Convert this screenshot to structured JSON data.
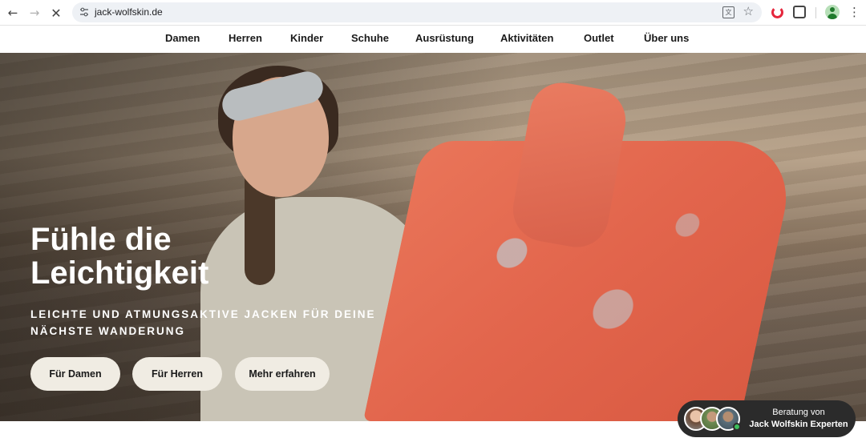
{
  "browser": {
    "url": "jack-wolfskin.de",
    "icons": [
      "back-icon",
      "forward-icon",
      "stop-icon",
      "tune-icon",
      "translate-icon",
      "bookmark-star-icon",
      "opera-extension-icon",
      "extensions-puzzle-icon",
      "profile-icon",
      "kebab-menu-icon"
    ]
  },
  "nav": {
    "items": [
      {
        "label": "Damen"
      },
      {
        "label": "Herren"
      },
      {
        "label": "Kinder"
      },
      {
        "label": "Schuhe"
      },
      {
        "label": "Ausrüstung"
      },
      {
        "label": "Aktivitäten"
      },
      {
        "label": "Outlet"
      },
      {
        "label": "Über uns"
      }
    ]
  },
  "hero": {
    "title_line1": "Fühle die",
    "title_line2": "Leichtigkeit",
    "subtitle_line1": "LEICHTE UND ATMUNGSAKTIVE JACKEN FÜR DEINE",
    "subtitle_line2": "NÄCHSTE WANDERUNG",
    "buttons": [
      {
        "label": "Für Damen"
      },
      {
        "label": "Für Herren"
      },
      {
        "label": "Mehr erfahren"
      }
    ]
  },
  "chat": {
    "line1": "Beratung von",
    "line2": "Jack Wolfskin Experten",
    "status": "online"
  },
  "colors": {
    "cta_bg": "#f0ece3",
    "jacket": "#e2654c",
    "chat_bg": "#2b2b2b",
    "online": "#3cc05c"
  }
}
